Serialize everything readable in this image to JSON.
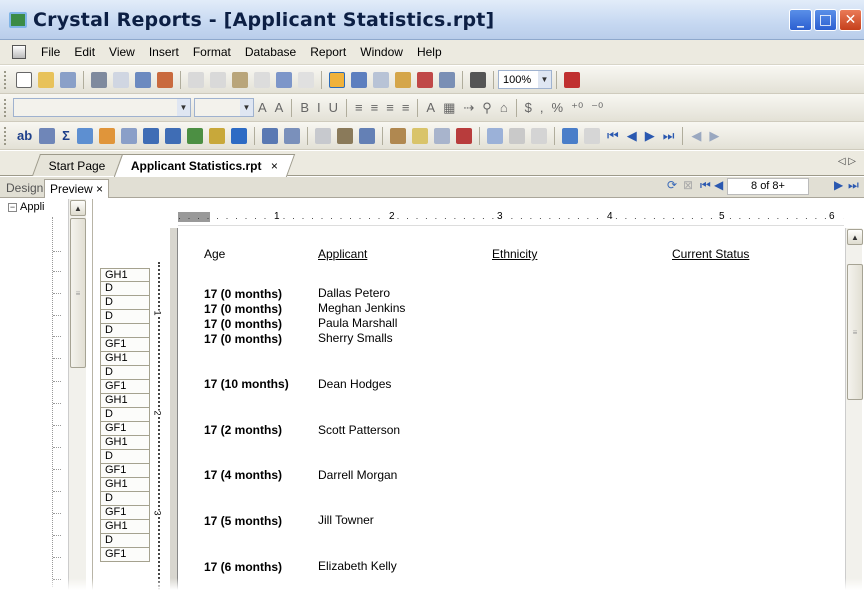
{
  "window": {
    "title": "Crystal Reports - [Applicant Statistics.rpt]",
    "minimize": "_",
    "maximize": "□",
    "close": "✕"
  },
  "menu": [
    "File",
    "Edit",
    "View",
    "Insert",
    "Format",
    "Database",
    "Report",
    "Window",
    "Help"
  ],
  "toolbar": {
    "zoom": "100%"
  },
  "doc_tabs": {
    "start_page": "Start Page",
    "active": "Applicant Statistics.rpt",
    "close": "×",
    "nav": "◁ ▷"
  },
  "view_tabs": {
    "design": "Design",
    "preview": "Preview",
    "close": "×"
  },
  "navigation": {
    "page_indicator": "8 of 8+"
  },
  "group_tree": {
    "root_label": "Appli"
  },
  "ruler": {
    "numbers": [
      "1",
      "2",
      "3",
      "4",
      "5",
      "6"
    ],
    "vertical_numbers": [
      "1",
      "2",
      "3"
    ]
  },
  "sections": [
    "GH1",
    "D",
    "D",
    "D",
    "D",
    "GF1",
    "GH1",
    "D",
    "GF1",
    "GH1",
    "D",
    "GF1",
    "GH1",
    "D",
    "GF1",
    "GH1",
    "D",
    "GF1",
    "GH1",
    "D",
    "GF1"
  ],
  "report": {
    "headers": {
      "age": "Age",
      "applicant": "Applicant",
      "ethnicity": "Ethnicity",
      "current_status": "Current Status"
    },
    "records": [
      {
        "age": "17 (0 months)",
        "name": "Dallas Petero"
      },
      {
        "age": "17 (0 months)",
        "name": "Meghan Jenkins"
      },
      {
        "age": "17 (0 months)",
        "name": "Paula Marshall"
      },
      {
        "age": "17 (0 months)",
        "name": "Sherry Smalls"
      },
      {
        "age": "17 (10 months)",
        "name": "Dean Hodges"
      },
      {
        "age": "17 (2 months)",
        "name": "Scott Patterson"
      },
      {
        "age": "17 (4 months)",
        "name": "Darrell Morgan"
      },
      {
        "age": "17 (5 months)",
        "name": "Jill Towner"
      },
      {
        "age": "17 (6 months)",
        "name": "Elizabeth Kelly"
      }
    ]
  },
  "colors": {
    "title_text": "#0c1f44",
    "menu_bg": "#eceae0",
    "close_btn": "#c5401c"
  }
}
